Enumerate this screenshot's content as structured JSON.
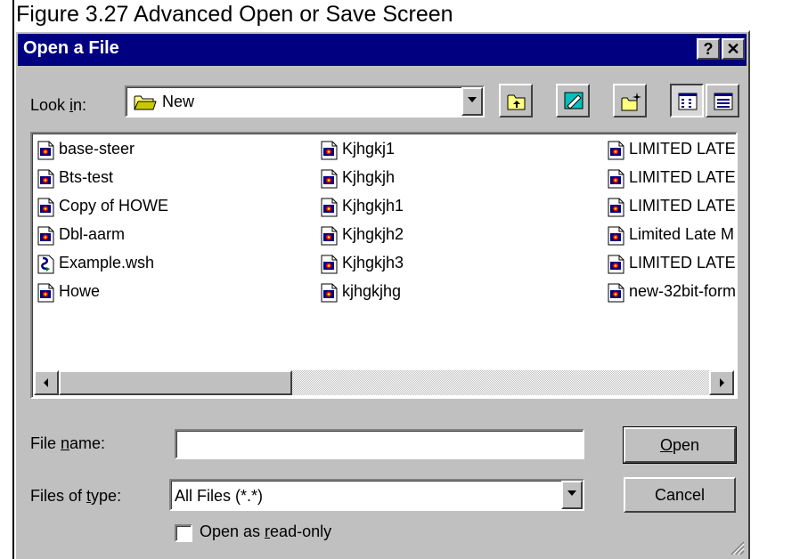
{
  "caption": "Figure 3.27  Advanced Open or Save Screen",
  "dialog": {
    "title": "Open a File",
    "help_label": "?",
    "close_label": "✕"
  },
  "look_in": {
    "label_pre": "Look ",
    "label_u": "i",
    "label_post": "n:",
    "value": "New"
  },
  "files": {
    "col1": [
      {
        "name": "base-steer",
        "icon": "document-icon"
      },
      {
        "name": "Bts-test",
        "icon": "document-icon"
      },
      {
        "name": "Copy of HOWE",
        "icon": "document-icon"
      },
      {
        "name": "Dbl-aarm",
        "icon": "document-icon"
      },
      {
        "name": "Example.wsh",
        "icon": "script-icon"
      },
      {
        "name": "Howe",
        "icon": "document-icon"
      }
    ],
    "col2": [
      {
        "name": "Kjhgkj1",
        "icon": "document-icon"
      },
      {
        "name": "Kjhgkjh",
        "icon": "document-icon"
      },
      {
        "name": "Kjhgkjh1",
        "icon": "document-icon"
      },
      {
        "name": "Kjhgkjh2",
        "icon": "document-icon"
      },
      {
        "name": "Kjhgkjh3",
        "icon": "document-icon"
      },
      {
        "name": "kjhgkjhg",
        "icon": "document-icon"
      }
    ],
    "col3": [
      {
        "name": "LIMITED LATE",
        "icon": "document-icon"
      },
      {
        "name": "LIMITED LATE",
        "icon": "document-icon"
      },
      {
        "name": "LIMITED LATE",
        "icon": "document-icon"
      },
      {
        "name": "Limited Late M",
        "icon": "document-icon"
      },
      {
        "name": "LIMITED LATE",
        "icon": "document-icon"
      },
      {
        "name": "new-32bit-form",
        "icon": "document-icon"
      }
    ]
  },
  "file_name": {
    "label_pre": "File ",
    "label_u": "n",
    "label_post": "ame:",
    "value": ""
  },
  "file_type": {
    "label_pre": "Files of ",
    "label_u": "t",
    "label_post": "ype:",
    "value": "All Files (*.*)"
  },
  "buttons": {
    "open_u": "O",
    "open_rest": "pen",
    "cancel": "Cancel"
  },
  "read_only": {
    "label_pre": "Open as ",
    "label_u": "r",
    "label_post": "ead-only"
  },
  "colors": {
    "titlebar": "#000080",
    "face": "#c0c0c0"
  }
}
